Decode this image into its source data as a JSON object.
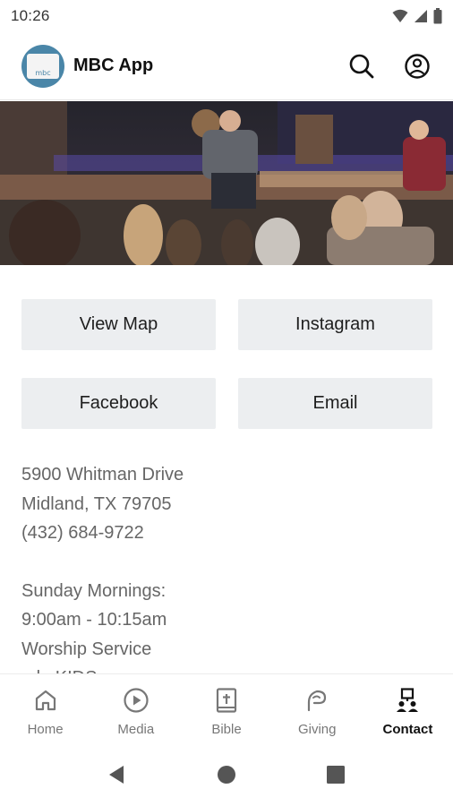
{
  "status_bar": {
    "time": "10:26",
    "icons": [
      "wifi-icon",
      "cell-signal-icon",
      "battery-icon"
    ]
  },
  "app_bar": {
    "title": "MBC App",
    "logo_text": "mbc",
    "actions": [
      "search-icon",
      "account-icon"
    ]
  },
  "buttons": [
    {
      "label": "View Map"
    },
    {
      "label": "Instagram"
    },
    {
      "label": "Facebook"
    },
    {
      "label": "Email"
    }
  ],
  "contact_info": {
    "address_line1": "5900 Whitman Drive",
    "address_line2": "Midland, TX 79705",
    "phone": "(432) 684-9722",
    "schedule_heading": "Sunday Mornings:",
    "schedule_time": "9:00am - 10:15am",
    "schedule_event": "Worship Service",
    "schedule_next": "mbcKIDS -"
  },
  "bottom_nav": {
    "items": [
      {
        "label": "Home",
        "icon": "home-icon",
        "active": false
      },
      {
        "label": "Media",
        "icon": "play-circle-icon",
        "active": false
      },
      {
        "label": "Bible",
        "icon": "bible-icon",
        "active": false
      },
      {
        "label": "Giving",
        "icon": "giving-icon",
        "active": false
      },
      {
        "label": "Contact",
        "icon": "contact-icon",
        "active": true
      }
    ]
  },
  "colors": {
    "accent": "#4a86a8",
    "button_bg": "#eceef0",
    "text_muted": "#666666"
  }
}
